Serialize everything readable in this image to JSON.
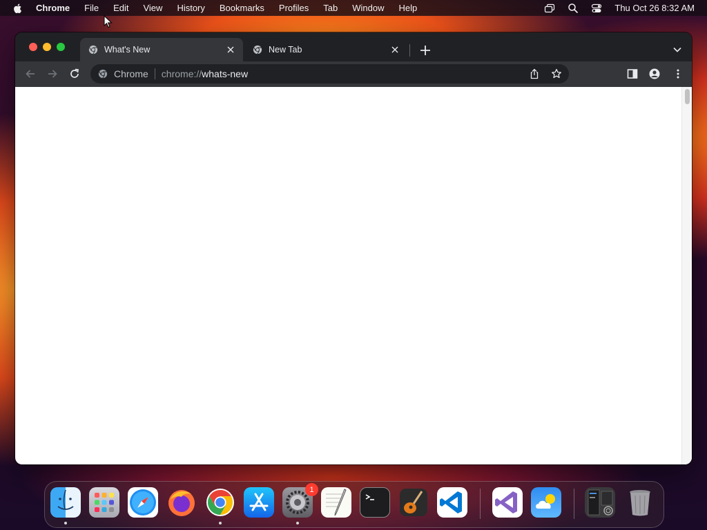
{
  "menubar": {
    "app_name": "Chrome",
    "items": [
      "File",
      "Edit",
      "View",
      "History",
      "Bookmarks",
      "Profiles",
      "Tab",
      "Window",
      "Help"
    ],
    "clock": "Thu Oct 26  8:32 AM",
    "right_icons": [
      "screen-mirroring-icon",
      "spotlight-search-icon",
      "control-center-icon"
    ]
  },
  "browser": {
    "tabs": [
      {
        "title": "What's New",
        "active": true,
        "favicon": "chrome-icon"
      },
      {
        "title": "New Tab",
        "active": false,
        "favicon": "chrome-icon"
      }
    ],
    "omnibox": {
      "chip_label": "Chrome",
      "url_scheme": "chrome://",
      "url_host": "whats-new"
    },
    "toolbar_icons": [
      "back-icon",
      "forward-icon",
      "reload-icon",
      "share-icon",
      "bookmark-star-icon",
      "side-panel-icon",
      "profile-icon",
      "menu-kebab-icon"
    ]
  },
  "dock": {
    "apps": [
      {
        "name": "Finder",
        "running": true
      },
      {
        "name": "Launchpad",
        "running": false
      },
      {
        "name": "Safari",
        "running": false
      },
      {
        "name": "Firefox",
        "running": false
      },
      {
        "name": "Google Chrome",
        "running": true
      },
      {
        "name": "App Store",
        "running": false
      },
      {
        "name": "System Settings",
        "running": true,
        "badge": "1"
      },
      {
        "name": "TextEdit",
        "running": false
      },
      {
        "name": "Terminal",
        "running": false
      },
      {
        "name": "GarageBand",
        "running": false
      },
      {
        "name": "Visual Studio Code",
        "running": false
      },
      {
        "name": "Visual Studio",
        "running": false
      },
      {
        "name": "Weather",
        "running": false
      },
      {
        "name": "Downloads Stack",
        "running": false
      },
      {
        "name": "Trash",
        "running": false
      }
    ]
  },
  "colors": {
    "window_bg": "#202124",
    "toolbar_bg": "#35363a",
    "content_bg": "#ffffff",
    "badge_red": "#ff3b30",
    "traffic_close": "#ff5f57",
    "traffic_min": "#febc2e",
    "traffic_max": "#28c840"
  }
}
